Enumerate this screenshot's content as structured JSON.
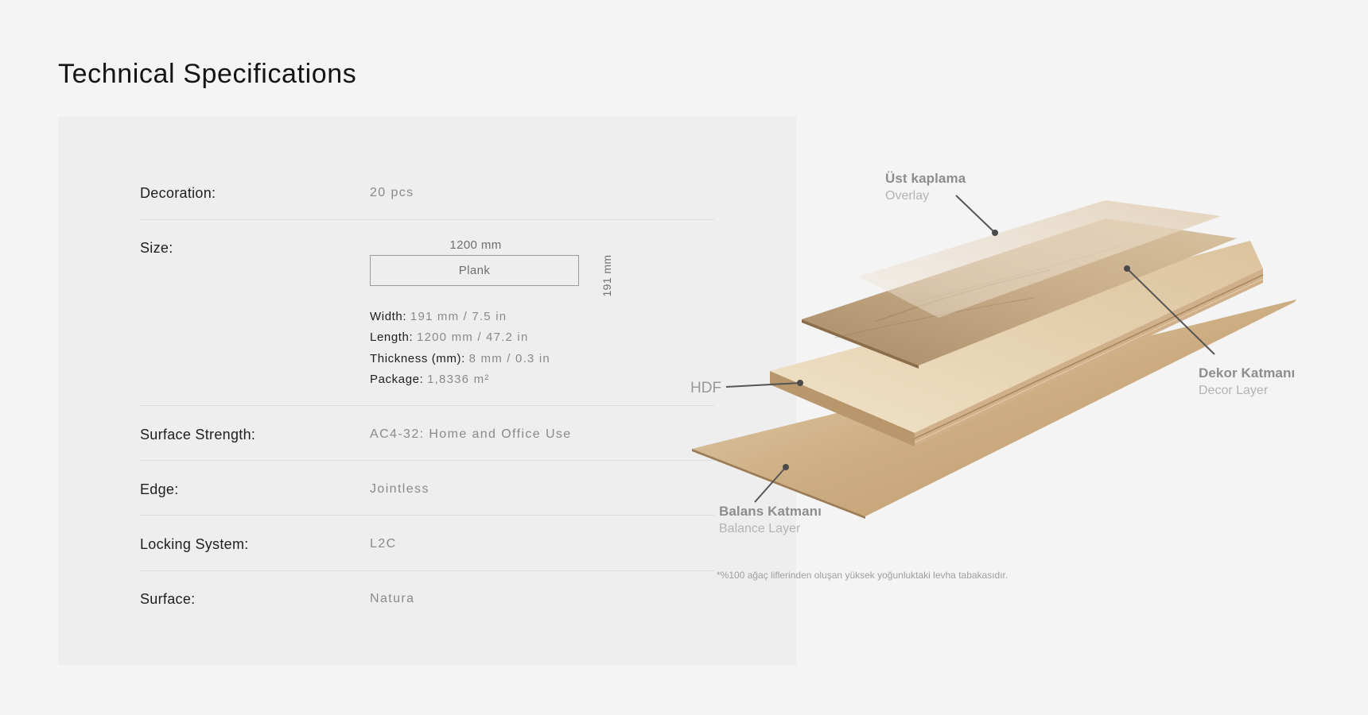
{
  "page": {
    "title": "Technical Specifications"
  },
  "specs": [
    {
      "label": "Decoration:",
      "value": "20 pcs"
    },
    {
      "label": "Size:",
      "value": ""
    },
    {
      "label": "Surface Strength:",
      "value": "AC4-32: Home and Office Use"
    },
    {
      "label": "Edge:",
      "value": "Jointless"
    },
    {
      "label": "Locking System:",
      "value": "L2C"
    },
    {
      "label": "Surface:",
      "value": "Natura"
    }
  ],
  "size": {
    "length_label": "1200 mm",
    "width_label": "191 mm",
    "shape": "Plank",
    "details": [
      {
        "key": "Width:",
        "value": "191 mm / 7.5 in"
      },
      {
        "key": "Length:",
        "value": "1200 mm / 47.2 in"
      },
      {
        "key": "Thickness (mm):",
        "value": "8 mm / 0.3 in"
      },
      {
        "key": "Package:",
        "value": "1,8336 m²"
      }
    ]
  },
  "layers": {
    "overlay": {
      "tr": "Üst kaplama",
      "en": "Overlay"
    },
    "decor": {
      "tr": "Dekor Katmanı",
      "en": "Decor Layer"
    },
    "hdf": "HDF",
    "balance": {
      "tr": "Balans Katmanı",
      "en": "Balance Layer"
    },
    "footnote": "*%100 ağaç liflerinden oluşan yüksek yoğunluktaki levha tabakasıdır."
  },
  "colors": {
    "background": "#f4f4f4",
    "panel": "#eeeeee",
    "wood": "#c9ab84"
  }
}
